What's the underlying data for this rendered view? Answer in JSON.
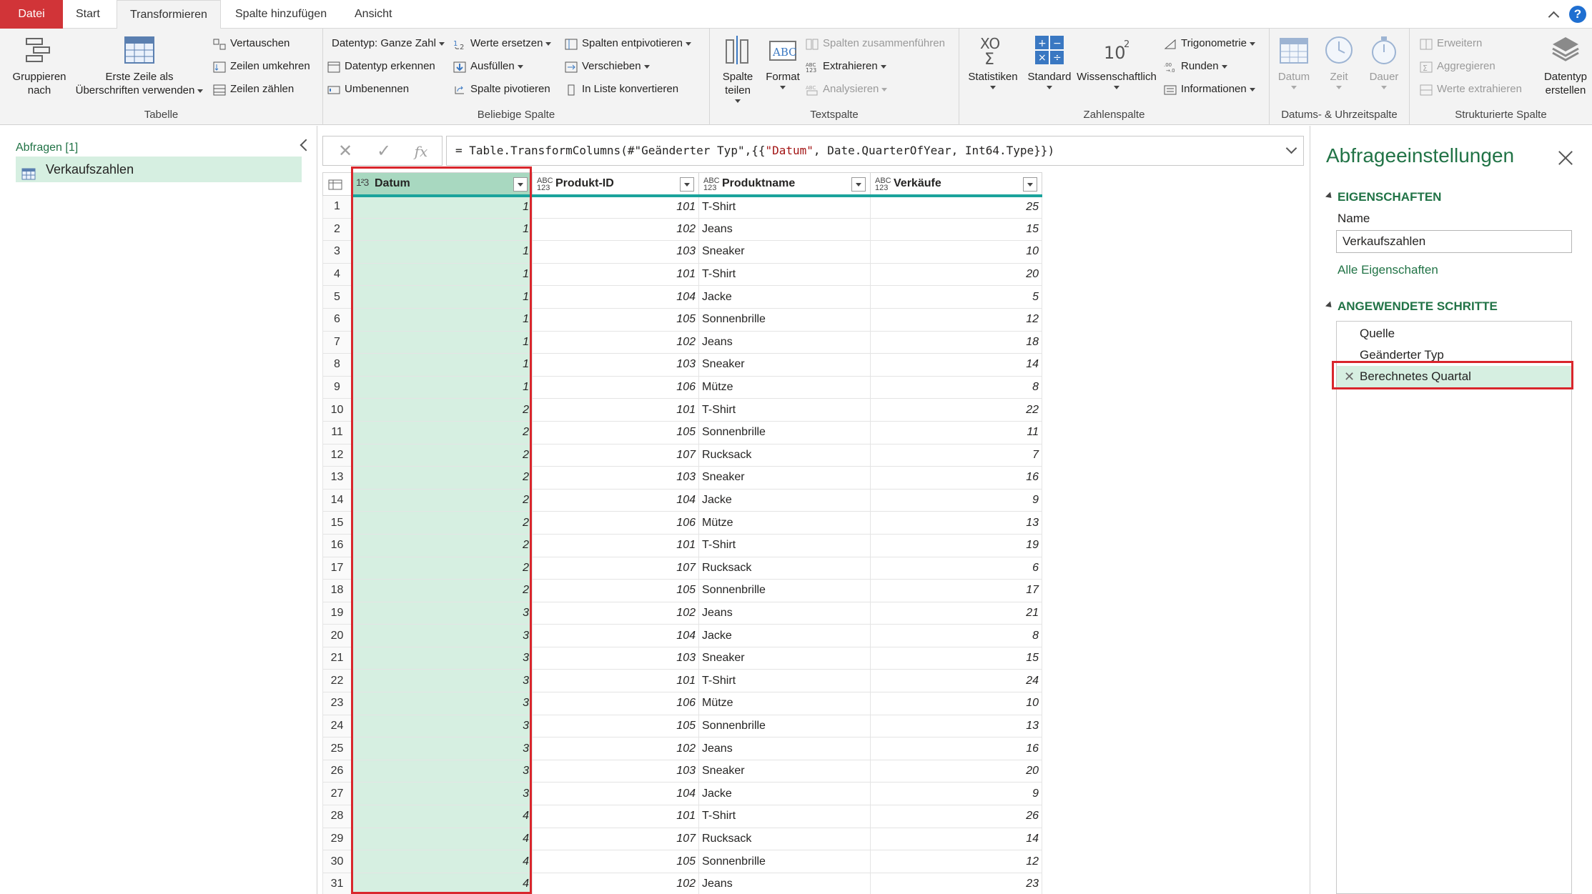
{
  "menu": {
    "tabs": [
      {
        "label": "Datei"
      },
      {
        "label": "Start"
      },
      {
        "label": "Transformieren"
      },
      {
        "label": "Spalte hinzufügen"
      },
      {
        "label": "Ansicht"
      }
    ],
    "help": "?"
  },
  "ribbon": {
    "tabelle": {
      "label": "Tabelle",
      "gruppieren": "Gruppieren\nnach",
      "erste_zeile": "Erste Zeile als\nÜberschriften verwenden",
      "vertauschen": "Vertauschen",
      "zeilen_umkehren": "Zeilen umkehren",
      "zeilen_zaehlen": "Zeilen zählen"
    },
    "beliebige": {
      "label": "Beliebige Spalte",
      "datentyp": "Datentyp: Ganze Zahl",
      "datentyp_erkennen": "Datentyp erkennen",
      "umbenennen": "Umbenennen",
      "werte_ersetzen": "Werte ersetzen",
      "ausfuellen": "Ausfüllen",
      "spalte_pivotieren": "Spalte pivotieren",
      "spalten_entpivotieren": "Spalten entpivotieren",
      "verschieben": "Verschieben",
      "in_liste": "In Liste konvertieren"
    },
    "text": {
      "label": "Textspalte",
      "spalte_teilen": "Spalte\nteilen",
      "format": "Format",
      "spalten_zusammen": "Spalten zusammenführen",
      "extrahieren": "Extrahieren",
      "analysieren": "Analysieren"
    },
    "zahlen": {
      "label": "Zahlenspalte",
      "statistiken": "Statistiken",
      "standard": "Standard",
      "wissenschaftlich": "Wissenschaftlich",
      "trigonometrie": "Trigonometrie",
      "runden": "Runden",
      "informationen": "Informationen"
    },
    "datum": {
      "label": "Datums- & Uhrzeitspalte",
      "datum": "Datum",
      "zeit": "Zeit",
      "dauer": "Dauer"
    },
    "struktur": {
      "label": "Strukturierte Spalte",
      "erweitern": "Erweitern",
      "aggregieren": "Aggregieren",
      "werte_extrahieren": "Werte extrahieren",
      "datentyp_erstellen": "Datentyp\nerstellen"
    }
  },
  "queries": {
    "title": "Abfragen [1]",
    "items": [
      {
        "name": "Verkaufszahlen"
      }
    ]
  },
  "formula": {
    "prefix": "= Table.TransformColumns(#\"Geänderter Typ\",{{",
    "column": "\"Datum\"",
    "suffix": ", Date.QuarterOfYear, Int64.Type}})"
  },
  "table": {
    "columns": [
      {
        "name": "Datum",
        "type": "123"
      },
      {
        "name": "Produkt-ID",
        "type": "ABC123"
      },
      {
        "name": "Produktname",
        "type": "ABC123"
      },
      {
        "name": "Verkäufe",
        "type": "ABC123"
      }
    ],
    "rows": [
      [
        1,
        1,
        101,
        "T-Shirt",
        25
      ],
      [
        2,
        1,
        102,
        "Jeans",
        15
      ],
      [
        3,
        1,
        103,
        "Sneaker",
        10
      ],
      [
        4,
        1,
        101,
        "T-Shirt",
        20
      ],
      [
        5,
        1,
        104,
        "Jacke",
        5
      ],
      [
        6,
        1,
        105,
        "Sonnenbrille",
        12
      ],
      [
        7,
        1,
        102,
        "Jeans",
        18
      ],
      [
        8,
        1,
        103,
        "Sneaker",
        14
      ],
      [
        9,
        1,
        106,
        "Mütze",
        8
      ],
      [
        10,
        2,
        101,
        "T-Shirt",
        22
      ],
      [
        11,
        2,
        105,
        "Sonnenbrille",
        11
      ],
      [
        12,
        2,
        107,
        "Rucksack",
        7
      ],
      [
        13,
        2,
        103,
        "Sneaker",
        16
      ],
      [
        14,
        2,
        104,
        "Jacke",
        9
      ],
      [
        15,
        2,
        106,
        "Mütze",
        13
      ],
      [
        16,
        2,
        101,
        "T-Shirt",
        19
      ],
      [
        17,
        2,
        107,
        "Rucksack",
        6
      ],
      [
        18,
        2,
        105,
        "Sonnenbrille",
        17
      ],
      [
        19,
        3,
        102,
        "Jeans",
        21
      ],
      [
        20,
        3,
        104,
        "Jacke",
        8
      ],
      [
        21,
        3,
        103,
        "Sneaker",
        15
      ],
      [
        22,
        3,
        101,
        "T-Shirt",
        24
      ],
      [
        23,
        3,
        106,
        "Mütze",
        10
      ],
      [
        24,
        3,
        105,
        "Sonnenbrille",
        13
      ],
      [
        25,
        3,
        102,
        "Jeans",
        16
      ],
      [
        26,
        3,
        103,
        "Sneaker",
        20
      ],
      [
        27,
        3,
        104,
        "Jacke",
        9
      ],
      [
        28,
        4,
        101,
        "T-Shirt",
        26
      ],
      [
        29,
        4,
        107,
        "Rucksack",
        14
      ],
      [
        30,
        4,
        105,
        "Sonnenbrille",
        12
      ],
      [
        31,
        4,
        102,
        "Jeans",
        23
      ]
    ]
  },
  "settings": {
    "title": "Abfrageeinstellungen",
    "eigenschaften": "EIGENSCHAFTEN",
    "name_label": "Name",
    "name_value": "Verkaufszahlen",
    "alle_eigenschaften": "Alle Eigenschaften",
    "schritte_title": "ANGEWENDETE SCHRITTE",
    "steps": [
      {
        "label": "Quelle"
      },
      {
        "label": "Geänderter Typ"
      },
      {
        "label": "Berechnetes Quartal"
      }
    ]
  },
  "colors": {
    "accent": "#217346",
    "file_tab": "#d13438",
    "selection": "#d6efe1",
    "highlight": "#d9262c",
    "header_rule": "#1ba39c"
  }
}
